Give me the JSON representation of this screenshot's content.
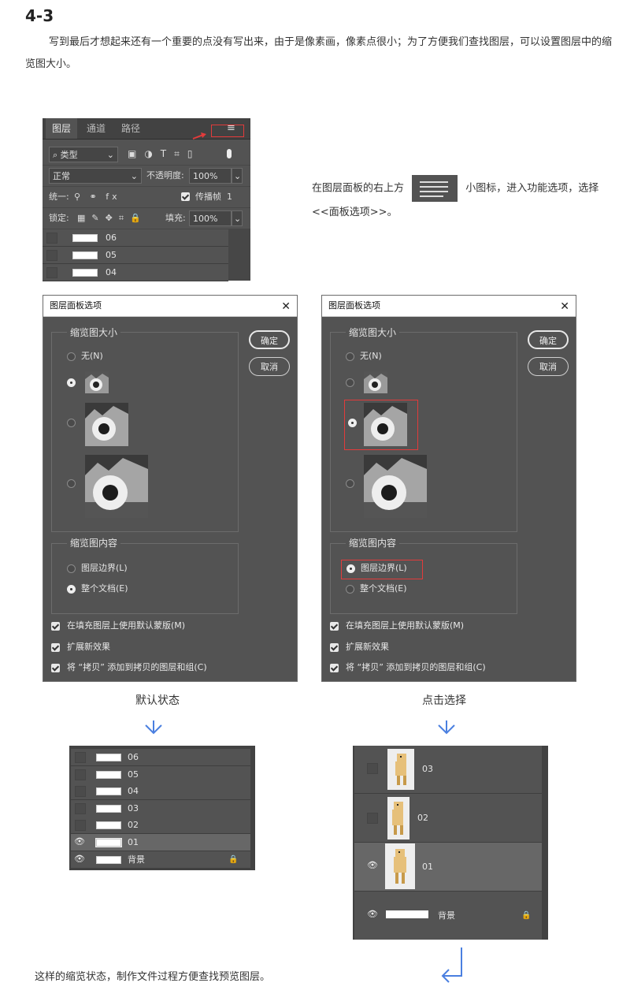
{
  "heading": "4-3",
  "intro": "写到最后才想起来还有一个重要的点没有写出来，由于是像素画，像素点很小；为了方便我们查找图层，可以设置图层中的缩览图大小。",
  "note": {
    "part1": "在图层面板的右上方",
    "part2": "小图标，进入功能选项，选择 <<面板选项>>。"
  },
  "layers_panel": {
    "tabs": [
      "图层",
      "通道",
      "路径"
    ],
    "menu_icon": "≡",
    "filter_kind": "类型",
    "blend_mode": "正常",
    "opacity_label": "不透明度:",
    "opacity_value": "100%",
    "unify_label": "统一:",
    "propagate_label": "传播帧",
    "propagate_value": "1",
    "lock_label": "锁定:",
    "fill_label": "填充:",
    "fill_value": "100%",
    "layers": [
      "06",
      "05",
      "04"
    ]
  },
  "dialog": {
    "title": "图层面板选项",
    "close": "✕",
    "thumb_size_group": "缩览图大小",
    "none_option": "无(N)",
    "ok": "确定",
    "cancel": "取消",
    "thumb_content_group": "缩览图内容",
    "layer_bounds": "图层边界(L)",
    "entire_doc": "整个文档(E)",
    "opt1": "在填充图层上使用默认蒙版(M)",
    "opt2": "扩展新效果",
    "opt3": "将 “拷贝” 添加到拷贝的图层和组(C)"
  },
  "caption_left": "默认状态",
  "caption_right": "点击选择",
  "small_layers": [
    "06",
    "05",
    "04",
    "03",
    "02",
    "01",
    "背景"
  ],
  "big_layers": [
    "03",
    "02",
    "01",
    "背景"
  ],
  "lock_icon": "🔒",
  "eye_icon": "👁",
  "footer": "这样的缩览状态，制作文件过程方便查找预览图层。",
  "colors": {
    "accent": "#4a7fe0",
    "highlight": "#e23b3b",
    "panel": "#535353"
  }
}
